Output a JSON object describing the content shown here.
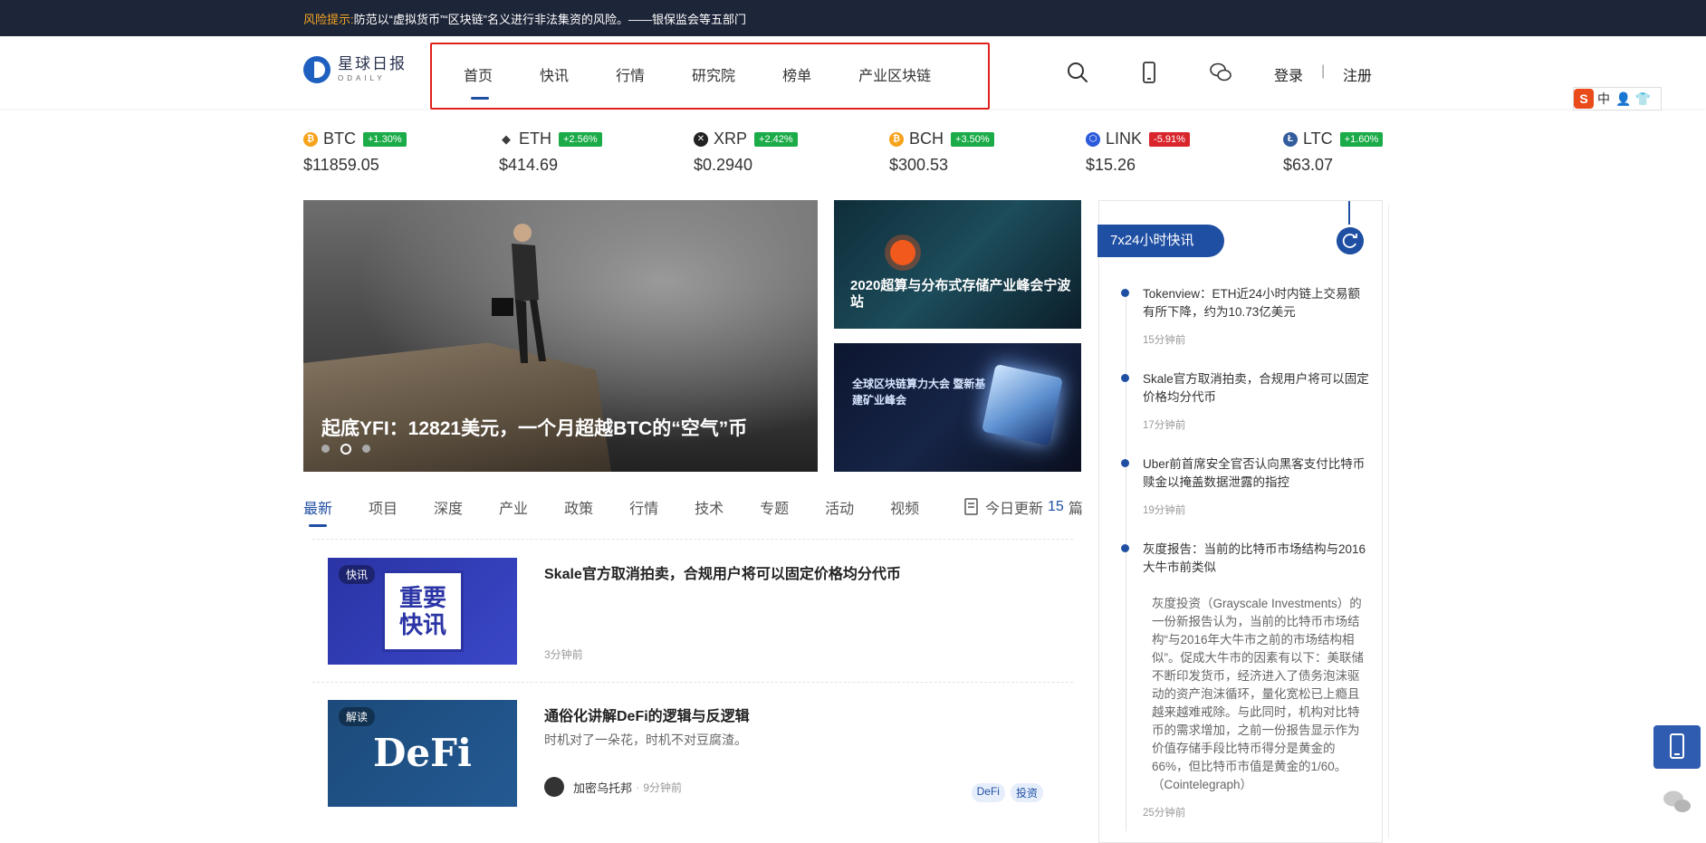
{
  "risk": {
    "label": "风险提示:",
    "text": "防范以“虚拟货币”“区块链”名义进行非法集资的风险。——银保监会等五部门"
  },
  "logo": {
    "cn": "星球日报",
    "en": "ODAILY"
  },
  "nav": [
    "首页",
    "快讯",
    "行情",
    "研究院",
    "榜单",
    "产业区块链"
  ],
  "auth": {
    "login": "登录",
    "sep": "|",
    "register": "注册"
  },
  "ime": {
    "lang": "中"
  },
  "colors": {
    "brand": "#1f4fa3",
    "up": "#1bab48",
    "down": "#d9262c",
    "nav_highlight": "#e0211e"
  },
  "tickers": [
    {
      "symbol": "BTC",
      "change": "+1.30%",
      "price": "$11859.05",
      "dir": "up",
      "color": "#f7a21b"
    },
    {
      "symbol": "ETH",
      "change": "+2.56%",
      "price": "$414.69",
      "dir": "up",
      "color": "#3c3c3d"
    },
    {
      "symbol": "XRP",
      "change": "+2.42%",
      "price": "$0.2940",
      "dir": "up",
      "color": "#222222"
    },
    {
      "symbol": "BCH",
      "change": "+3.50%",
      "price": "$300.53",
      "dir": "up",
      "color": "#f7a21b"
    },
    {
      "symbol": "LINK",
      "change": "-5.91%",
      "price": "$15.26",
      "dir": "down",
      "color": "#2a5ada"
    },
    {
      "symbol": "LTC",
      "change": "+1.60%",
      "price": "$63.07",
      "dir": "up",
      "color": "#345d9d"
    }
  ],
  "hero": {
    "title": "起底YFI：12821美元，一个月超越BTC的“空气”币"
  },
  "side_cards": [
    {
      "title": "2020超算与分布式存储产业峰会宁波站"
    },
    {
      "title": "全球区块链算力大会 暨新基建矿业峰会"
    }
  ],
  "categories": [
    "最新",
    "项目",
    "深度",
    "产业",
    "政策",
    "行情",
    "技术",
    "专题",
    "活动",
    "视频"
  ],
  "update": {
    "prefix": "今日更新",
    "count": "15",
    "suffix": "篇"
  },
  "articles": [
    {
      "tag": "快讯",
      "thumb_text": "重要 快讯",
      "title": "Skale官方取消拍卖，合规用户将可以固定价格均分代币",
      "time": "3分钟前"
    },
    {
      "tag": "解读",
      "thumb_text": "DeFi",
      "title": "通俗化讲解DeFi的逻辑与反逻辑",
      "desc": "时机对了一朵花，时机不对豆腐渣。",
      "author": "加密乌托邦",
      "time": "9分钟前",
      "chips": [
        "DeFi",
        "投资"
      ]
    }
  ],
  "flash": {
    "title": "7x24小时快讯",
    "items": [
      {
        "title": "Tokenview：ETH近24小时内链上交易额有所下降，约为10.73亿美元",
        "time": "15分钟前"
      },
      {
        "title": "Skale官方取消拍卖，合规用户将可以固定价格均分代币",
        "time": "17分钟前"
      },
      {
        "title": "Uber前首席安全官否认向黑客支付比特币赎金以掩盖数据泄露的指控",
        "time": "19分钟前"
      },
      {
        "title": "灰度报告：当前的比特币市场结构与2016大牛市前类似",
        "body": "灰度投资（Grayscale Investments）的一份新报告认为，当前的比特币市场结构“与2016年大牛市之前的市场结构相似”。促成大牛市的因素有以下：美联储不断印发货币，经济进入了债务泡沫驱动的资产泡沫循环，量化宽松已上瘾且越来越难戒除。与此同时，机构对比特币的需求增加，之前一份报告显示作为价值存储手段比特币得分是黄金的66%，但比特币市值是黄金的1/60。（Cointelegraph）",
        "time": "25分钟前"
      }
    ]
  }
}
